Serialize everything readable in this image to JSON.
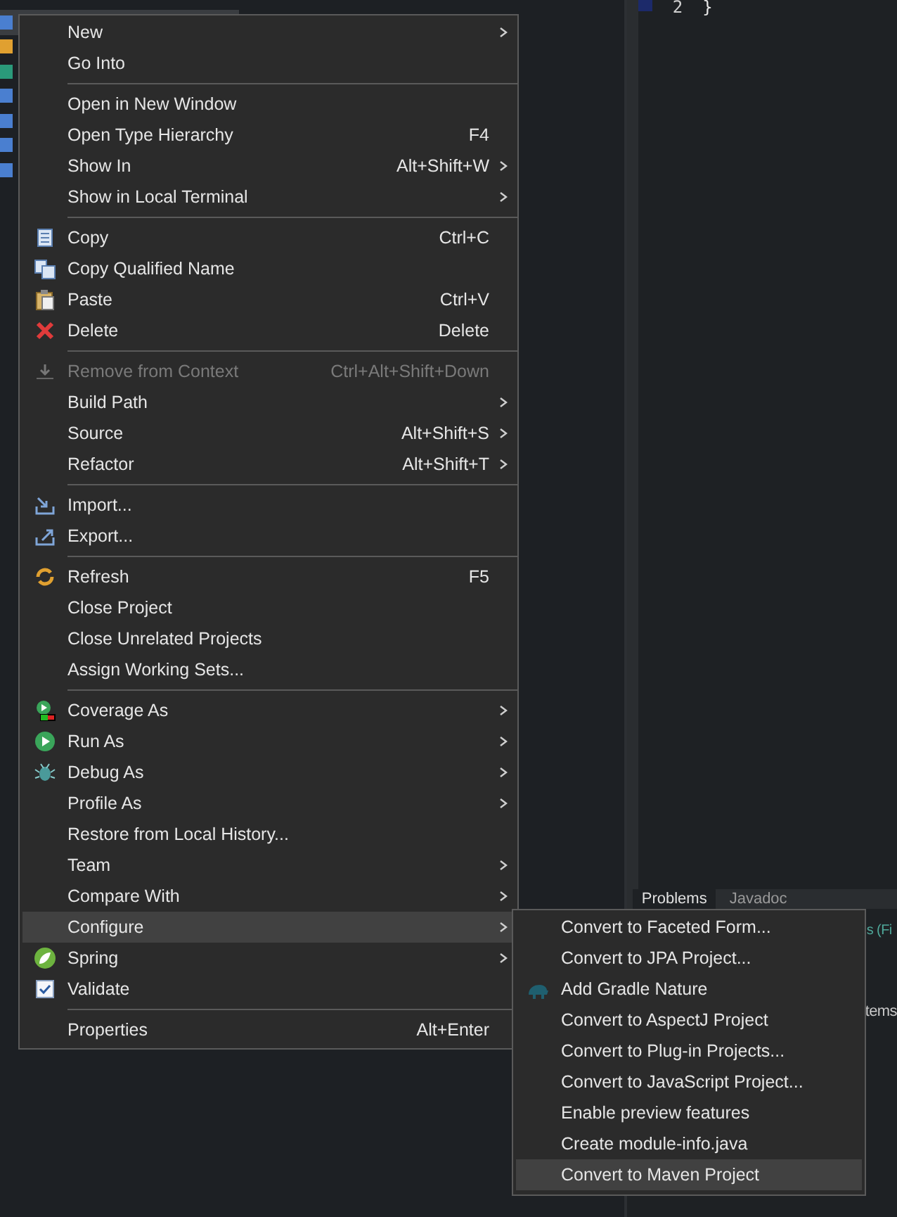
{
  "sidebar": {
    "items": [
      {
        "selected": true
      },
      {
        "selected": false
      },
      {
        "selected": false
      },
      {
        "selected": false
      },
      {
        "selected": false
      },
      {
        "selected": false
      },
      {
        "selected": false
      }
    ]
  },
  "editor": {
    "line_number": "2",
    "code": "}"
  },
  "bottom_panel": {
    "tabs": [
      {
        "label": "Problems",
        "selected": true
      },
      {
        "label": "Javadoc",
        "selected": false
      }
    ],
    "fragment_1": "s (Fi",
    "fragment_2": "tems"
  },
  "context_menu": {
    "items": [
      {
        "kind": "item",
        "label": "New",
        "submenu": true
      },
      {
        "kind": "item",
        "label": "Go Into"
      },
      {
        "kind": "separator"
      },
      {
        "kind": "item",
        "label": "Open in New Window"
      },
      {
        "kind": "item",
        "label": "Open Type Hierarchy",
        "shortcut": "F4"
      },
      {
        "kind": "item",
        "label": "Show In",
        "shortcut": "Alt+Shift+W",
        "submenu": true
      },
      {
        "kind": "item",
        "label": "Show in Local Terminal",
        "submenu": true
      },
      {
        "kind": "separator"
      },
      {
        "kind": "item",
        "label": "Copy",
        "shortcut": "Ctrl+C"
      },
      {
        "kind": "item",
        "label": "Copy Qualified Name"
      },
      {
        "kind": "item",
        "label": "Paste",
        "shortcut": "Ctrl+V"
      },
      {
        "kind": "item",
        "label": "Delete",
        "shortcut": "Delete"
      },
      {
        "kind": "separator"
      },
      {
        "kind": "item",
        "label": "Remove from Context",
        "shortcut": "Ctrl+Alt+Shift+Down",
        "disabled": true
      },
      {
        "kind": "item",
        "label": "Build Path",
        "submenu": true
      },
      {
        "kind": "item",
        "label": "Source",
        "shortcut": "Alt+Shift+S",
        "submenu": true
      },
      {
        "kind": "item",
        "label": "Refactor",
        "shortcut": "Alt+Shift+T",
        "submenu": true
      },
      {
        "kind": "separator"
      },
      {
        "kind": "item",
        "label": "Import..."
      },
      {
        "kind": "item",
        "label": "Export..."
      },
      {
        "kind": "separator"
      },
      {
        "kind": "item",
        "label": "Refresh",
        "shortcut": "F5"
      },
      {
        "kind": "item",
        "label": "Close Project"
      },
      {
        "kind": "item",
        "label": "Close Unrelated Projects"
      },
      {
        "kind": "item",
        "label": "Assign Working Sets..."
      },
      {
        "kind": "separator"
      },
      {
        "kind": "item",
        "label": "Coverage As",
        "submenu": true
      },
      {
        "kind": "item",
        "label": "Run As",
        "submenu": true
      },
      {
        "kind": "item",
        "label": "Debug As",
        "submenu": true
      },
      {
        "kind": "item",
        "label": "Profile As",
        "submenu": true
      },
      {
        "kind": "item",
        "label": "Restore from Local History..."
      },
      {
        "kind": "item",
        "label": "Team",
        "submenu": true
      },
      {
        "kind": "item",
        "label": "Compare With",
        "submenu": true
      },
      {
        "kind": "item",
        "label": "Configure",
        "submenu": true,
        "selected": true
      },
      {
        "kind": "item",
        "label": "Spring",
        "submenu": true
      },
      {
        "kind": "item",
        "label": "Validate"
      },
      {
        "kind": "separator"
      },
      {
        "kind": "item",
        "label": "Properties",
        "shortcut": "Alt+Enter"
      }
    ]
  },
  "submenu": {
    "items": [
      {
        "label": "Convert to Faceted Form...",
        "selected": false
      },
      {
        "label": "Convert to JPA Project...",
        "selected": false
      },
      {
        "label": "Add Gradle Nature",
        "selected": false
      },
      {
        "label": "Convert to AspectJ Project",
        "selected": false
      },
      {
        "label": "Convert to Plug-in Projects...",
        "selected": false
      },
      {
        "label": "Convert to JavaScript Project...",
        "selected": false
      },
      {
        "label": "Enable preview features",
        "selected": false
      },
      {
        "label": "Create module-info.java",
        "selected": false
      },
      {
        "label": "Convert to Maven Project",
        "selected": true
      }
    ]
  }
}
